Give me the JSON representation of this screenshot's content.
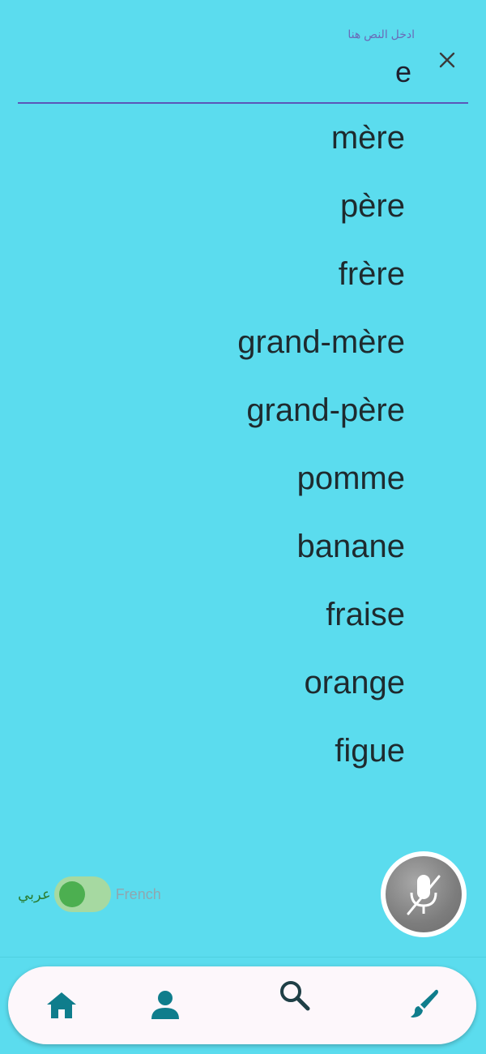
{
  "search": {
    "label": "ادخل النص هنا",
    "value": "e",
    "clear_icon": "close-icon"
  },
  "results": [
    "mère",
    "père",
    "frère",
    "grand-mère",
    "grand-père",
    "pomme",
    "banane",
    "fraise",
    "orange",
    "figue"
  ],
  "language_toggle": {
    "left_label": "عربي",
    "right_label": "French",
    "selected": "عربي"
  },
  "mic": {
    "icon": "mic-off-icon",
    "state": "muted"
  },
  "bottom_nav": {
    "items": [
      {
        "icon": "home-icon"
      },
      {
        "icon": "person-icon"
      },
      {
        "icon": "search-icon"
      },
      {
        "icon": "brush-icon"
      }
    ]
  },
  "colors": {
    "background": "#5bdcee",
    "accent": "#5b57b8",
    "nav_icon": "#0f7d8c",
    "toggle_on": "#4caf50"
  }
}
